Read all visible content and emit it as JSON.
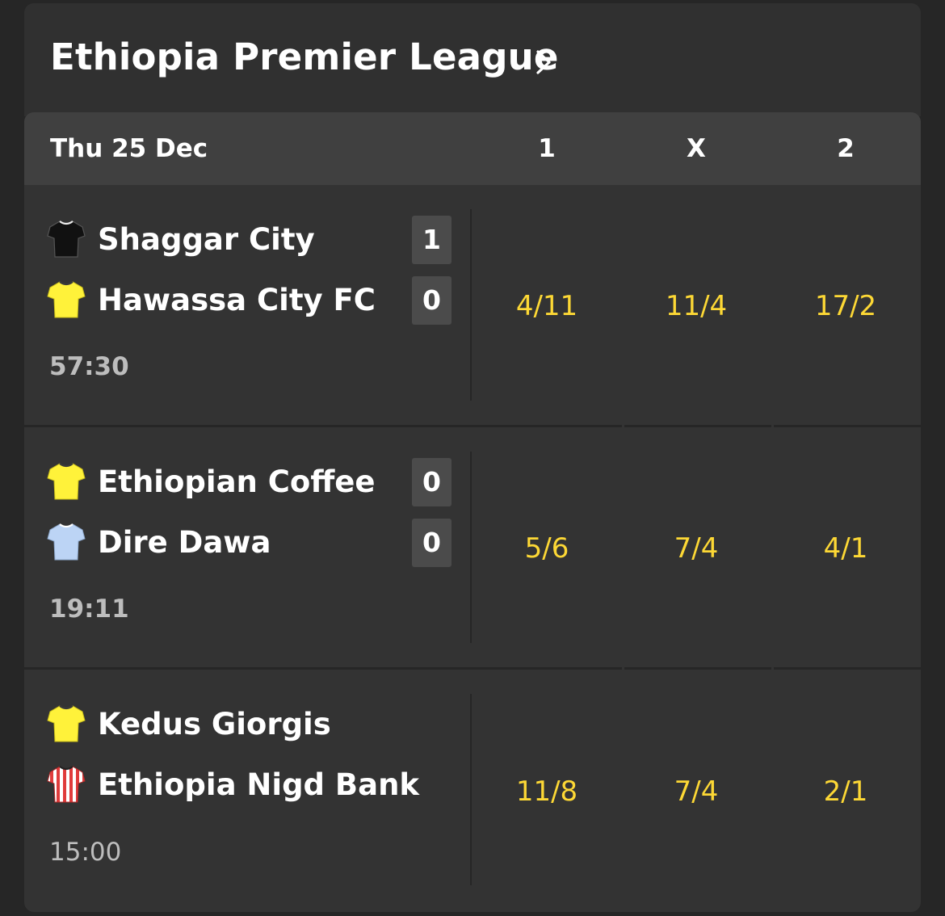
{
  "league": {
    "title": "Ethiopia Premier League"
  },
  "table_header": {
    "date": "Thu 25 Dec",
    "col_1": "1",
    "col_x": "X",
    "col_2": "2"
  },
  "matches": [
    {
      "home": {
        "name": "Shaggar City",
        "score": "1",
        "shirt": "black-shirt-icon"
      },
      "away": {
        "name": "Hawassa City FC",
        "score": "0",
        "shirt": "yellow-shirt-icon"
      },
      "time": "57:30",
      "odds": {
        "home": "4/11",
        "draw": "11/4",
        "away": "17/2"
      }
    },
    {
      "home": {
        "name": "Ethiopian Coffee",
        "score": "0",
        "shirt": "yellow-shirt-icon"
      },
      "away": {
        "name": "Dire Dawa",
        "score": "0",
        "shirt": "light-blue-shirt-icon"
      },
      "time": "19:11",
      "odds": {
        "home": "5/6",
        "draw": "7/4",
        "away": "4/1"
      }
    },
    {
      "home": {
        "name": "Kedus Giorgis",
        "shirt": "yellow-shirt-icon"
      },
      "away": {
        "name": "Ethiopia Nigd Bank",
        "shirt": "red-white-striped-shirt-icon"
      },
      "time": "15:00",
      "odds": {
        "home": "11/8",
        "draw": "7/4",
        "away": "2/1"
      }
    }
  ],
  "colors": {
    "background": "#262626",
    "card": "#333333",
    "header_bar": "#404040",
    "score_box": "#4b4b4b",
    "odds": "#fdd835",
    "shirt_yellow": "#fff23a",
    "shirt_black": "#111111",
    "shirt_light_blue": "#bcd4f5",
    "shirt_red_stripe": "#e03b3b"
  }
}
